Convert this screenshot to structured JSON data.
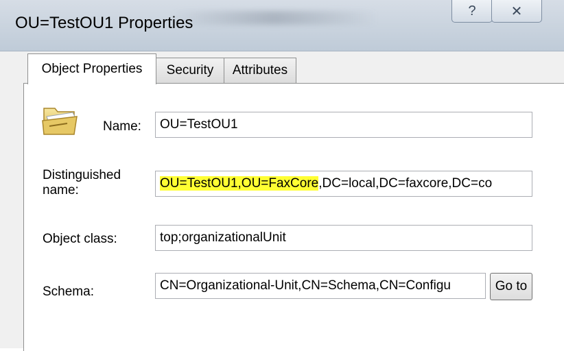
{
  "window": {
    "title": "OU=TestOU1 Properties",
    "help_glyph": "?",
    "close_glyph": "✕"
  },
  "tabs": [
    {
      "label": "Object Properties",
      "active": true
    },
    {
      "label": "Security",
      "active": false
    },
    {
      "label": "Attributes",
      "active": false
    }
  ],
  "form": {
    "name_label": "Name:",
    "name_value": "OU=TestOU1",
    "dn_label_line1": "Distinguished",
    "dn_label_line2": "name:",
    "dn_value_highlighted": "OU=TestOU1,OU=FaxCore",
    "dn_value_rest": ",DC=local,DC=faxcore,DC=co",
    "class_label": "Object class:",
    "class_value": "top;organizationalUnit",
    "schema_label": "Schema:",
    "schema_value": "CN=Organizational-Unit,CN=Schema,CN=Configu",
    "goto_label": "Go to"
  },
  "colors": {
    "highlight": "#ffff33"
  },
  "icons": {
    "object": "folder-icon"
  }
}
